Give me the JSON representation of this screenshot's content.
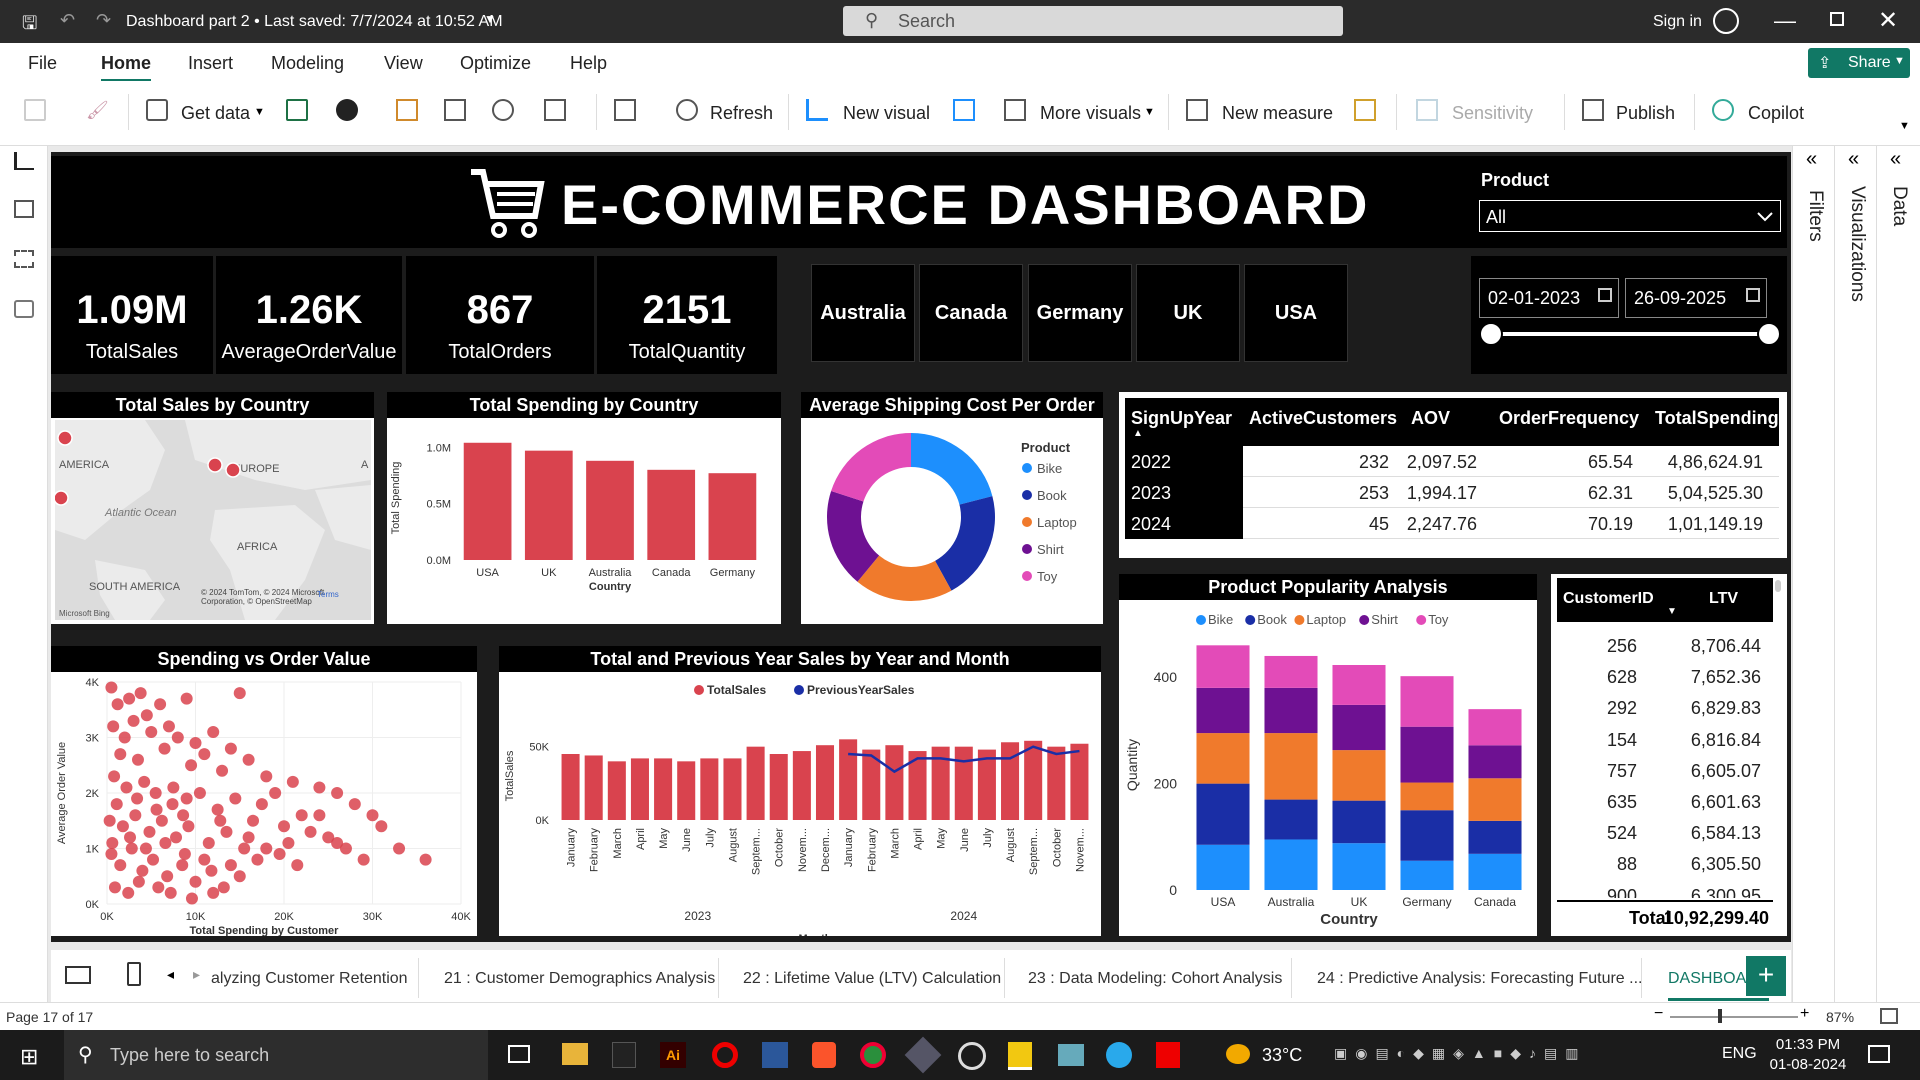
{
  "titlebar": {
    "doc_title": "Dashboard part 2 • Last saved: 7/7/2024 at 10:52 AM",
    "search_placeholder": "Search",
    "signin": "Sign in"
  },
  "menu": [
    "File",
    "Home",
    "Insert",
    "Modeling",
    "View",
    "Optimize",
    "Help"
  ],
  "share_label": "Share",
  "ribbon": {
    "get_data": "Get data",
    "refresh": "Refresh",
    "new_visual": "New visual",
    "more_visuals": "More visuals",
    "new_measure": "New measure",
    "sensitivity": "Sensitivity",
    "publish": "Publish",
    "copilot": "Copilot"
  },
  "right_panels": {
    "filters": "Filters",
    "visualizations": "Visualizations",
    "data": "Data"
  },
  "dashboard": {
    "title": "E-COMMERCE DASHBOARD",
    "product_slicer": {
      "label": "Product",
      "value": "All"
    },
    "date_from": "02-01-2023",
    "date_to": "26-09-2025",
    "kpis": [
      {
        "value": "1.09M",
        "label": "TotalSales"
      },
      {
        "value": "1.26K",
        "label": "AverageOrderValue"
      },
      {
        "value": "867",
        "label": "TotalOrders"
      },
      {
        "value": "2151",
        "label": "TotalQuantity"
      }
    ],
    "countries": [
      "Australia",
      "Canada",
      "Germany",
      "UK",
      "USA"
    ],
    "map": {
      "title": "Total Sales by Country",
      "labels": [
        "AMERICA",
        "EUROPE",
        "Atlantic Ocean",
        "AFRICA",
        "SOUTH AMERICA",
        "A"
      ],
      "attribution": "© 2024 TomTom, © 2024 Microsoft Corporation, © OpenStreetMap",
      "terms": "Terms",
      "brand": "Microsoft Bing"
    },
    "table_signup": {
      "columns": [
        "SignUpYear",
        "ActiveCustomers",
        "AOV",
        "OrderFrequency",
        "TotalSpending"
      ],
      "rows": [
        [
          "2022",
          "232",
          "2,097.52",
          "65.54",
          "4,86,624.91"
        ],
        [
          "2023",
          "253",
          "1,994.17",
          "62.31",
          "5,04,525.30"
        ],
        [
          "2024",
          "45",
          "2,247.76",
          "70.19",
          "1,01,149.19"
        ]
      ]
    },
    "table_ltv": {
      "columns": [
        "CustomerID",
        "LTV"
      ],
      "rows": [
        [
          "256",
          "8,706.44"
        ],
        [
          "628",
          "7,652.36"
        ],
        [
          "292",
          "6,829.83"
        ],
        [
          "154",
          "6,816.84"
        ],
        [
          "757",
          "6,605.07"
        ],
        [
          "635",
          "6,601.63"
        ],
        [
          "524",
          "6,584.13"
        ],
        [
          "88",
          "6,305.50"
        ],
        [
          "900",
          "6,300.95"
        ]
      ],
      "total_label": "Total",
      "total_value": "10,92,299.40"
    }
  },
  "chart_data": [
    {
      "id": "spending",
      "type": "bar",
      "title": "Total Spending by Country",
      "xlabel": "Country",
      "ylabel": "Total Spending",
      "categories": [
        "USA",
        "UK",
        "Australia",
        "Canada",
        "Germany"
      ],
      "values": [
        1040000,
        970000,
        880000,
        800000,
        770000
      ],
      "ylim": [
        0,
        1100000
      ],
      "yticks": [
        {
          "v": 0,
          "label": "0.0M"
        },
        {
          "v": 500000,
          "label": "0.5M"
        },
        {
          "v": 1000000,
          "label": "1.0M"
        }
      ],
      "color": "#d9434e"
    },
    {
      "id": "shipping",
      "type": "pie",
      "title": "Average Shipping Cost Per Order",
      "legend_title": "Product",
      "categories": [
        "Bike",
        "Book",
        "Laptop",
        "Shirt",
        "Toy"
      ],
      "values": [
        21,
        21,
        19,
        19,
        20
      ],
      "colors": [
        "#1d8ffd",
        "#1a2ea6",
        "#f07a2c",
        "#6e1192",
        "#e34bb8"
      ]
    },
    {
      "id": "scatter",
      "type": "scatter",
      "title": "Spending vs Order Value",
      "xlabel": "Total Spending by Customer",
      "ylabel": "Average Order Value",
      "xlim": [
        0,
        40000
      ],
      "ylim": [
        0,
        4000
      ],
      "xticks": [
        {
          "v": 0,
          "label": "0K"
        },
        {
          "v": 10000,
          "label": "10K"
        },
        {
          "v": 20000,
          "label": "20K"
        },
        {
          "v": 30000,
          "label": "30K"
        },
        {
          "v": 40000,
          "label": "40K"
        }
      ],
      "yticks": [
        {
          "v": 0,
          "label": "0K"
        },
        {
          "v": 1000,
          "label": "1K"
        },
        {
          "v": 2000,
          "label": "2K"
        },
        {
          "v": 3000,
          "label": "3K"
        },
        {
          "v": 4000,
          "label": "4K"
        }
      ],
      "points": [
        [
          500,
          3900
        ],
        [
          1200,
          3600
        ],
        [
          2500,
          3700
        ],
        [
          3800,
          3800
        ],
        [
          4500,
          3400
        ],
        [
          6000,
          3600
        ],
        [
          9000,
          3700
        ],
        [
          15000,
          3800
        ],
        [
          700,
          3200
        ],
        [
          2000,
          3000
        ],
        [
          3000,
          3300
        ],
        [
          5000,
          3100
        ],
        [
          7000,
          3200
        ],
        [
          8000,
          3000
        ],
        [
          10000,
          2900
        ],
        [
          12000,
          3100
        ],
        [
          14000,
          2800
        ],
        [
          1500,
          2700
        ],
        [
          3500,
          2600
        ],
        [
          6500,
          2800
        ],
        [
          9500,
          2500
        ],
        [
          11000,
          2700
        ],
        [
          13000,
          2400
        ],
        [
          16000,
          2600
        ],
        [
          18000,
          2300
        ],
        [
          19000,
          2000
        ],
        [
          21000,
          2200
        ],
        [
          24000,
          2100
        ],
        [
          26000,
          2000
        ],
        [
          28000,
          1800
        ],
        [
          30000,
          1600
        ],
        [
          800,
          2300
        ],
        [
          2200,
          2100
        ],
        [
          4200,
          2200
        ],
        [
          5500,
          2000
        ],
        [
          7500,
          2100
        ],
        [
          9000,
          1900
        ],
        [
          10500,
          2000
        ],
        [
          12500,
          1700
        ],
        [
          14500,
          1900
        ],
        [
          16500,
          1500
        ],
        [
          17500,
          1800
        ],
        [
          20000,
          1400
        ],
        [
          22000,
          1600
        ],
        [
          23000,
          1300
        ],
        [
          25000,
          1200
        ],
        [
          27000,
          1000
        ],
        [
          29000,
          800
        ],
        [
          33000,
          1000
        ],
        [
          36000,
          800
        ],
        [
          300,
          1500
        ],
        [
          1800,
          1400
        ],
        [
          3200,
          1600
        ],
        [
          4800,
          1300
        ],
        [
          6200,
          1500
        ],
        [
          7800,
          1200
        ],
        [
          9200,
          1400
        ],
        [
          11500,
          1100
        ],
        [
          13500,
          1300
        ],
        [
          15500,
          1000
        ],
        [
          19500,
          900
        ],
        [
          21500,
          700
        ],
        [
          24000,
          1600
        ],
        [
          26000,
          1100
        ],
        [
          31000,
          1400
        ],
        [
          500,
          900
        ],
        [
          1500,
          700
        ],
        [
          2800,
          1000
        ],
        [
          4000,
          600
        ],
        [
          5200,
          800
        ],
        [
          6800,
          500
        ],
        [
          8500,
          700
        ],
        [
          10000,
          400
        ],
        [
          11800,
          600
        ],
        [
          13200,
          300
        ],
        [
          15000,
          500
        ],
        [
          17000,
          800
        ],
        [
          900,
          300
        ],
        [
          2400,
          200
        ],
        [
          3600,
          400
        ],
        [
          5800,
          300
        ],
        [
          7200,
          200
        ],
        [
          9600,
          100
        ],
        [
          12000,
          200
        ],
        [
          600,
          1100
        ],
        [
          2600,
          1200
        ],
        [
          4400,
          1000
        ],
        [
          6600,
          1100
        ],
        [
          8800,
          900
        ],
        [
          11000,
          800
        ],
        [
          14000,
          700
        ],
        [
          1100,
          1800
        ],
        [
          3400,
          1900
        ],
        [
          5600,
          1700
        ],
        [
          7400,
          1800
        ],
        [
          8600,
          1600
        ],
        [
          12800,
          1500
        ],
        [
          16000,
          1200
        ],
        [
          18000,
          1000
        ],
        [
          20500,
          1100
        ]
      ],
      "color": "#d9434e"
    },
    {
      "id": "sales",
      "type": "bar",
      "title": "Total and Previous Year Sales by Year and Month",
      "xlabel": "Month",
      "ylabel": "TotalSales",
      "series": [
        {
          "name": "TotalSales",
          "color": "#d9434e"
        },
        {
          "name": "PreviousYearSales",
          "color": "#1a2ea6"
        }
      ],
      "categories": [
        "January",
        "February",
        "March",
        "April",
        "May",
        "June",
        "July",
        "August",
        "Septem...",
        "October",
        "Novem...",
        "Decem...",
        "January",
        "February",
        "March",
        "April",
        "May",
        "June",
        "July",
        "August",
        "Septem...",
        "October",
        "Novem..."
      ],
      "year_groups": [
        {
          "label": "2023",
          "start": 0,
          "end": 11
        },
        {
          "label": "2024",
          "start": 12,
          "end": 22
        }
      ],
      "values": [
        45000,
        44000,
        40000,
        42000,
        42000,
        40000,
        42000,
        42000,
        50000,
        45000,
        47000,
        51000,
        55000,
        48000,
        51000,
        47000,
        50000,
        50000,
        48000,
        53000,
        54000,
        50000,
        52000
      ],
      "previous": [
        null,
        null,
        null,
        null,
        null,
        null,
        null,
        null,
        null,
        null,
        null,
        null,
        45000,
        44000,
        33000,
        42000,
        42000,
        40000,
        42000,
        42000,
        50000,
        45000,
        47000
      ],
      "ylim": [
        0,
        60000
      ],
      "yticks": [
        {
          "v": 0,
          "label": "0K"
        },
        {
          "v": 50000,
          "label": "50K"
        }
      ]
    },
    {
      "id": "popularity",
      "type": "bar",
      "title": "Product Popularity Analysis",
      "xlabel": "Country",
      "ylabel": "Quantity",
      "stacked": true,
      "categories": [
        "USA",
        "Australia",
        "UK",
        "Germany",
        "Canada"
      ],
      "series": [
        {
          "name": "Bike",
          "color": "#1d8ffd",
          "values": [
            85,
            95,
            88,
            55,
            68
          ]
        },
        {
          "name": "Book",
          "color": "#1a2ea6",
          "values": [
            115,
            75,
            80,
            95,
            62
          ]
        },
        {
          "name": "Laptop",
          "color": "#f07a2c",
          "values": [
            95,
            125,
            95,
            52,
            80
          ]
        },
        {
          "name": "Shirt",
          "color": "#6e1192",
          "values": [
            85,
            85,
            85,
            105,
            62
          ]
        },
        {
          "name": "Toy",
          "color": "#e34bb8",
          "values": [
            80,
            60,
            75,
            95,
            68
          ]
        }
      ],
      "ylim": [
        0,
        470
      ],
      "yticks": [
        {
          "v": 0,
          "label": "0"
        },
        {
          "v": 200,
          "label": "200"
        },
        {
          "v": 400,
          "label": "400"
        }
      ]
    }
  ],
  "page_tabs": [
    "alyzing Customer Retention",
    "21 : Customer Demographics Analysis",
    "22 : Lifetime Value (LTV) Calculation",
    "23 : Data Modeling: Cohort Analysis",
    "24 : Predictive Analysis: Forecasting Future ...",
    "DASHBOARD"
  ],
  "status": {
    "page": "Page 17 of 17",
    "zoom": "87%"
  },
  "taskbar": {
    "search_placeholder": "Type here to search",
    "temperature": "33°C",
    "lang": "ENG",
    "time": "01:33 PM",
    "date": "01-08-2024"
  }
}
